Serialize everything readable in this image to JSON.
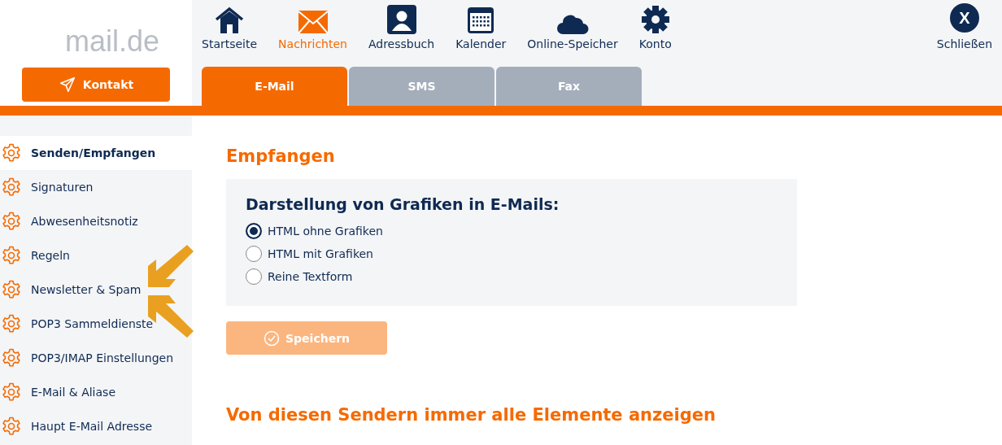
{
  "logo": {
    "text": "mail.de"
  },
  "contact_button": {
    "label": "Kontakt"
  },
  "nav": [
    {
      "label": "Startseite",
      "kind": "home",
      "selected": false
    },
    {
      "label": "Nachrichten",
      "kind": "mail",
      "selected": true
    },
    {
      "label": "Adressbuch",
      "kind": "contacts",
      "selected": false
    },
    {
      "label": "Kalender",
      "kind": "calendar",
      "selected": false
    },
    {
      "label": "Online-Speicher",
      "kind": "cloud",
      "selected": false
    },
    {
      "label": "Konto",
      "kind": "gear",
      "selected": false
    }
  ],
  "close": {
    "glyph": "X",
    "label": "Schließen"
  },
  "tabs": [
    {
      "label": "E-Mail",
      "selected": true
    },
    {
      "label": "SMS",
      "selected": false
    },
    {
      "label": "Fax",
      "selected": false
    }
  ],
  "sidebar": {
    "items": [
      {
        "label": "Senden/Empfangen",
        "selected": true
      },
      {
        "label": "Signaturen",
        "selected": false
      },
      {
        "label": "Abwesenheitsnotiz",
        "selected": false
      },
      {
        "label": "Regeln",
        "selected": false
      },
      {
        "label": "Newsletter & Spam",
        "selected": false
      },
      {
        "label": "POP3 Sammeldienste",
        "selected": false
      },
      {
        "label": "POP3/IMAP Einstellungen",
        "selected": false
      },
      {
        "label": "E-Mail & Aliase",
        "selected": false
      },
      {
        "label": "Haupt E-Mail Adresse",
        "selected": false
      }
    ]
  },
  "section": {
    "heading": "Empfangen",
    "panel_title": "Darstellung von Grafiken in E-Mails:",
    "options": [
      {
        "label": "HTML ohne Grafiken",
        "selected": true
      },
      {
        "label": "HTML mit Grafiken",
        "selected": false
      },
      {
        "label": "Reine Textform",
        "selected": false
      }
    ],
    "save_button": {
      "label": "Speichern",
      "disabled": true
    }
  },
  "section_2": {
    "heading": "Von diesen Sendern immer alle Elemente anzeigen"
  }
}
